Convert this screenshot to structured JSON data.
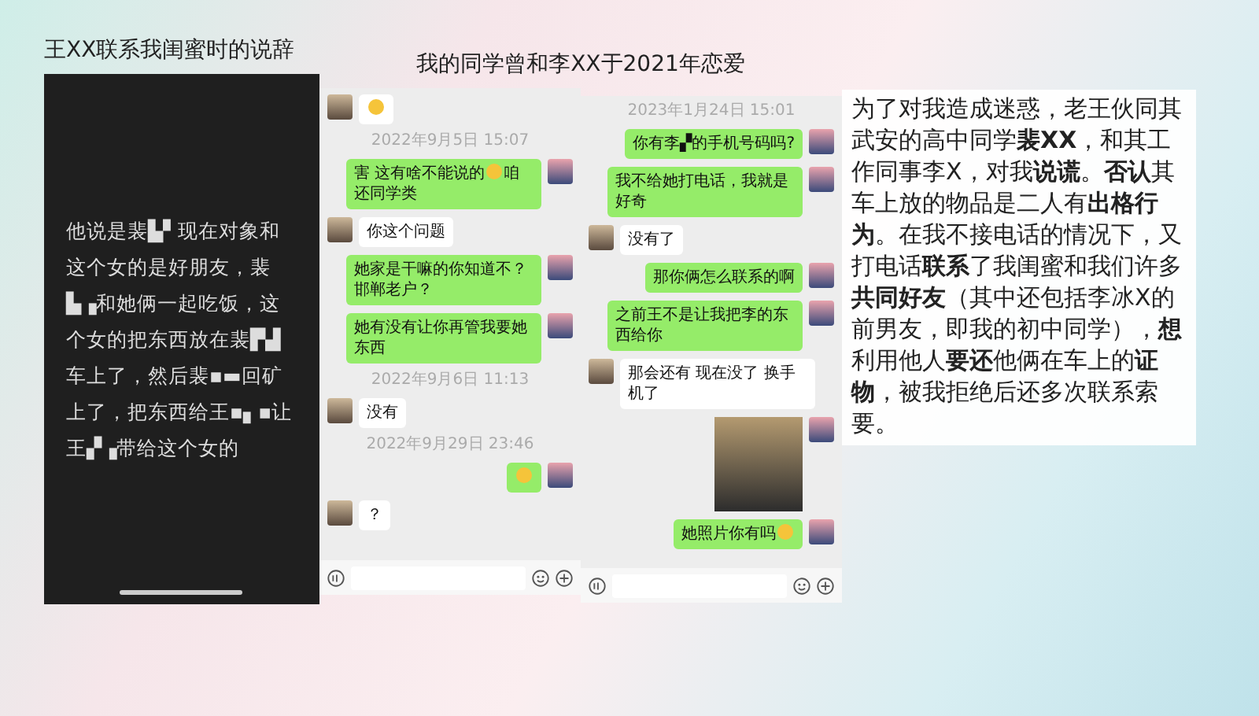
{
  "left_panel": {
    "title": "王XX联系我闺蜜时的说辞",
    "message": "他说是裴▙▘现在对象和这个女的是好朋友，裴▙▗和她俩一起吃饭，这个女的把东西放在裴▛▟车上了，然后裴▪▬回矿上了，把东西给王▪▖▪让王▞▗带给这个女的"
  },
  "chats_title": "我的同学曾和李XX于2021年恋爱",
  "chats": [
    {
      "messages": [
        {
          "kind": "received",
          "emoji": true
        },
        {
          "kind": "time",
          "text": "2022年9月5日 15:07"
        },
        {
          "kind": "sent",
          "text": "害 这有啥不能说的",
          "emoji": true,
          "text_after": "咱还同学类"
        },
        {
          "kind": "received",
          "text": "你这个问题"
        },
        {
          "kind": "sent",
          "text": "她家是干嘛的你知道不？邯郸老户？"
        },
        {
          "kind": "sent",
          "text": "她有没有让你再管我要她东西"
        },
        {
          "kind": "time",
          "text": "2022年9月6日 11:13"
        },
        {
          "kind": "received",
          "text": "没有"
        },
        {
          "kind": "time",
          "text": "2022年9月29日 23:46"
        },
        {
          "kind": "sent",
          "emoji": true
        },
        {
          "kind": "received",
          "text": "？"
        }
      ]
    },
    {
      "messages": [
        {
          "kind": "time",
          "text": "2023年1月24日 15:01"
        },
        {
          "kind": "sent",
          "text": "你有李▞的手机号码吗?"
        },
        {
          "kind": "sent",
          "text": "我不给她打电话，我就是好奇"
        },
        {
          "kind": "received",
          "text": "没有了"
        },
        {
          "kind": "sent",
          "text": "那你俩怎么联系的啊"
        },
        {
          "kind": "sent",
          "text": "之前王不是让我把李的东西给你"
        },
        {
          "kind": "received",
          "text": "那会还有 现在没了 换手机了"
        },
        {
          "kind": "sent_photo"
        },
        {
          "kind": "sent",
          "text": "她照片你有吗",
          "emoji": true
        }
      ]
    }
  ],
  "statement": {
    "text": "为了对我造成迷惑，老王伙同其武安的高中同学**裴XX**，和其工作同事李X，对我**说谎**。**否认**其车上放的物品是二人有**出格行为**。在我不接电话的情况下，又打电话**联系**了我闺蜜和我们许多**共同好友**（其中还包括李冰X的前男友，即我的初中同学），**想**利用他人**要还**他俩在车上的**证物**，被我拒绝后还多次联系索要。"
  }
}
